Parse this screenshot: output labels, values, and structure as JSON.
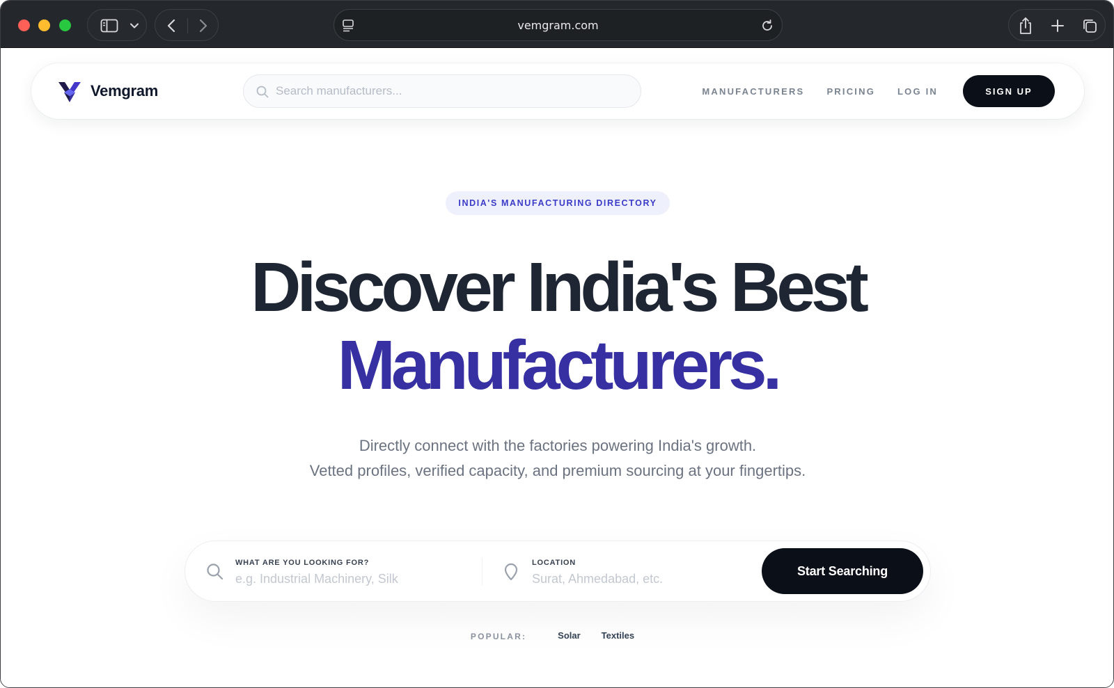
{
  "browser": {
    "url": "vemgram.com"
  },
  "nav": {
    "brand": "Vemgram",
    "search_placeholder": "Search manufacturers...",
    "links": [
      "MANUFACTURERS",
      "PRICING",
      "LOG IN"
    ],
    "signup": "SIGN UP"
  },
  "hero": {
    "badge": "INDIA'S MANUFACTURING DIRECTORY",
    "title_line_1": "Discover India's Best",
    "title_line_2": "Manufacturers.",
    "subtitle_line_1": "Directly connect with the factories powering India's growth.",
    "subtitle_line_2": "Vetted profiles, verified capacity, and premium sourcing at your fingertips."
  },
  "search": {
    "what_label": "WHAT ARE YOU LOOKING FOR?",
    "what_placeholder": "e.g. Industrial Machinery, Silk",
    "location_label": "LOCATION",
    "location_placeholder": "Surat, Ahmedabad, etc.",
    "submit": "Start Searching"
  },
  "popular": {
    "label": "POPULAR:",
    "tags": [
      "Solar",
      "Textiles"
    ]
  },
  "colors": {
    "accent": "#3730a3",
    "heading": "#1e2533",
    "button": "#0b0f17",
    "badge_bg": "#eef0fb"
  },
  "icons": {
    "sidebar": "sidebar-icon",
    "chevron": "chevron-down-icon",
    "back": "back-arrow-icon",
    "forward": "forward-arrow-icon",
    "reader": "reader-mode-icon",
    "reload": "reload-icon",
    "share": "share-icon",
    "new_tab": "plus-icon",
    "tabs": "tab-overview-icon",
    "search": "search-icon",
    "location": "location-pin-icon",
    "logo": "vemgram-logo-icon"
  }
}
